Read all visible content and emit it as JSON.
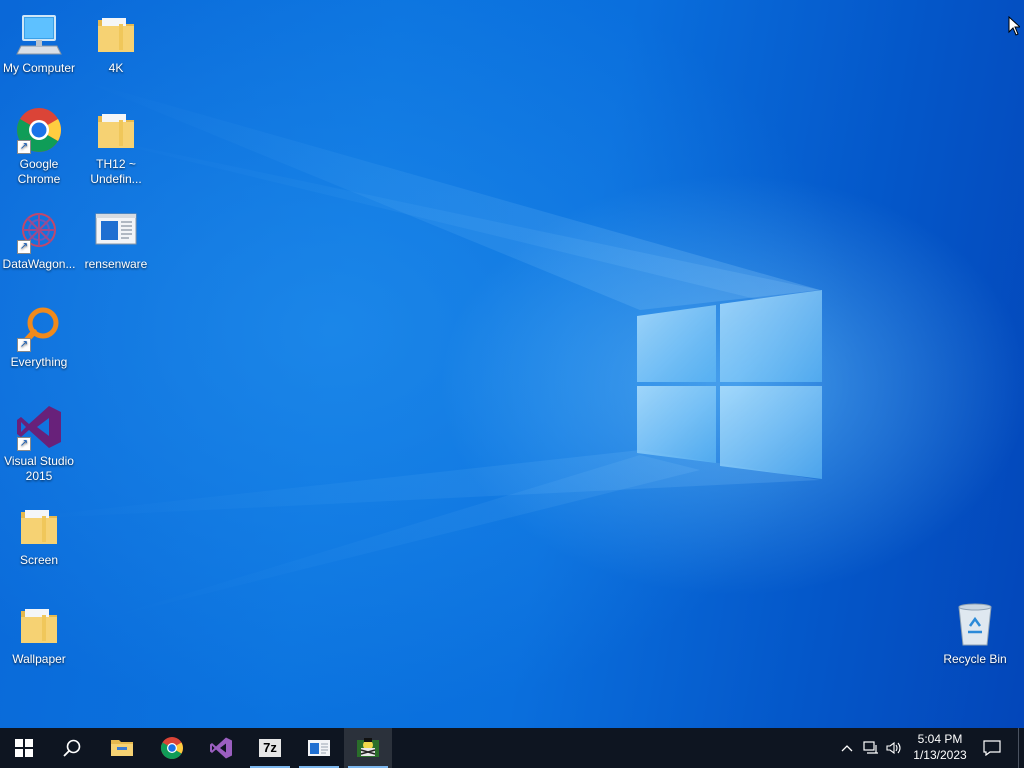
{
  "desktop": {
    "icons": [
      {
        "label": "My Computer",
        "icon": "computer-icon"
      },
      {
        "label": "4K",
        "icon": "folder-icon"
      },
      {
        "label": "Google Chrome",
        "icon": "chrome-icon"
      },
      {
        "label": "TH12 ~ Undefin...",
        "icon": "folder-icon"
      },
      {
        "label": "DataWagon...",
        "icon": "datawagon-icon"
      },
      {
        "label": "rensenware",
        "icon": "rensenware-icon"
      },
      {
        "label": "Everything",
        "icon": "everything-search-icon"
      },
      {
        "label": "Visual Studio 2015",
        "icon": "visual-studio-icon"
      },
      {
        "label": "Screen",
        "icon": "folder-icon"
      },
      {
        "label": "Wallpaper",
        "icon": "folder-icon"
      },
      {
        "label": "Recycle Bin",
        "icon": "recycle-bin-icon"
      }
    ]
  },
  "taskbar": {
    "pinned": [
      {
        "name": "start",
        "icon": "windows-start-icon"
      },
      {
        "name": "search",
        "icon": "search-icon"
      },
      {
        "name": "file-explorer",
        "icon": "file-explorer-icon"
      },
      {
        "name": "chrome",
        "icon": "chrome-icon"
      },
      {
        "name": "visual-studio",
        "icon": "visual-studio-icon"
      },
      {
        "name": "7-zip",
        "icon": "7zip-icon",
        "label": "7z"
      },
      {
        "name": "rensenware",
        "icon": "rensenware-icon"
      },
      {
        "name": "game-app",
        "icon": "game-app-icon"
      }
    ],
    "tray": {
      "time": "5:04 PM",
      "date": "1/13/2023",
      "icons": [
        "chevron-up-icon",
        "network-icon",
        "volume-icon",
        "notification-icon"
      ]
    }
  },
  "colors": {
    "taskbar_bg": "#0e1521",
    "desktop_blue": "#0a6fdd",
    "running_indicator": "#7cb7ef"
  }
}
